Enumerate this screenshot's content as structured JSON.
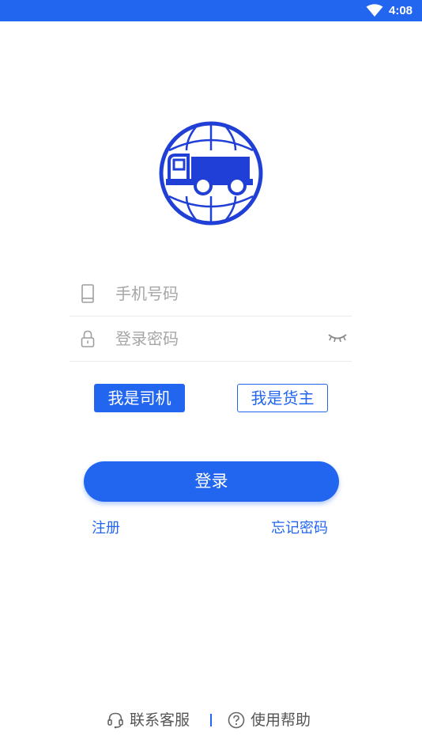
{
  "status_bar": {
    "time": "4:08",
    "wifi_icon": "wifi-icon"
  },
  "logo": {
    "icon": "globe-truck-logo"
  },
  "form": {
    "phone": {
      "icon": "phone-icon",
      "placeholder": "手机号码",
      "value": ""
    },
    "password": {
      "icon": "lock-icon",
      "placeholder": "登录密码",
      "value": "",
      "toggle_icon": "eye-closed-icon"
    }
  },
  "roles": {
    "driver_label": "我是司机",
    "shipper_label": "我是货主",
    "selected": "driver"
  },
  "login_label": "登录",
  "links": {
    "register": "注册",
    "forgot_password": "忘记密码"
  },
  "footer": {
    "service_label": "联系客服",
    "service_icon": "headset-icon",
    "help_label": "使用帮助",
    "help_icon": "question-circle-icon"
  },
  "colors": {
    "accent": "#2266f0",
    "logo": "#1f3fd6",
    "placeholder": "#a6a6a6",
    "divider": "#ebebeb"
  }
}
